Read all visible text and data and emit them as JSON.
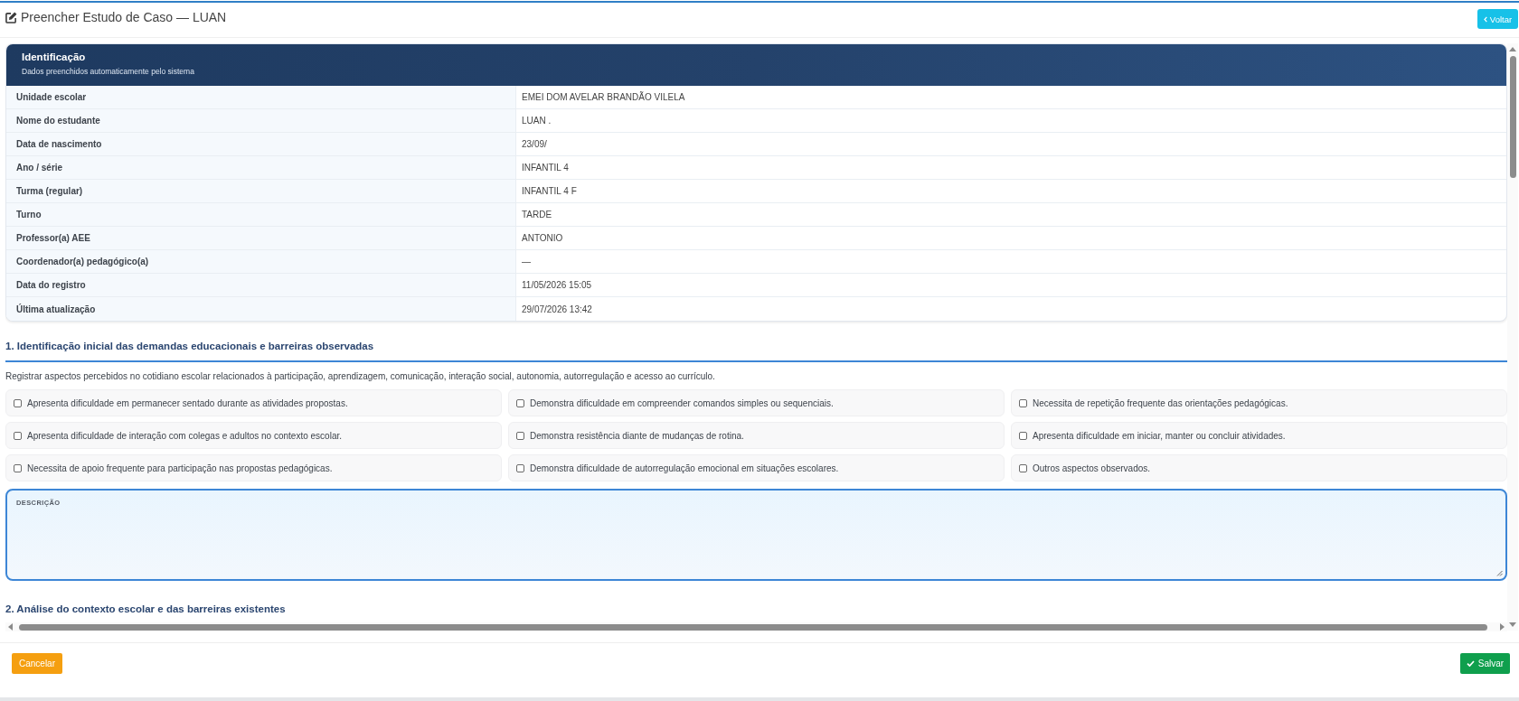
{
  "page": {
    "title": "Preencher Estudo de Caso — LUAN",
    "back_button": "Voltar"
  },
  "identification": {
    "title": "Identificação",
    "subtitle": "Dados preenchidos automaticamente pelo sistema",
    "rows": [
      {
        "label": "Unidade escolar",
        "value": "EMEI DOM AVELAR BRANDÃO VILELA"
      },
      {
        "label": "Nome do estudante",
        "value": "LUAN ."
      },
      {
        "label": "Data de nascimento",
        "value": "23/09/"
      },
      {
        "label": "Ano / série",
        "value": "INFANTIL 4"
      },
      {
        "label": "Turma (regular)",
        "value": "INFANTIL 4 F"
      },
      {
        "label": "Turno",
        "value": "TARDE"
      },
      {
        "label": "Professor(a) AEE",
        "value": "ANTONIO"
      },
      {
        "label": "Coordenador(a) pedagógico(a)",
        "value": "—"
      },
      {
        "label": "Data do registro",
        "value": "11/05/2026 15:05"
      },
      {
        "label": "Última atualização",
        "value": "29/07/2026 13:42"
      }
    ]
  },
  "sections": [
    {
      "title": "1. Identificação inicial das demandas educacionais e barreiras observadas",
      "description": "Registrar aspectos percebidos no cotidiano escolar relacionados à participação, aprendizagem, comunicação, interação social, autonomia, autorregulação e acesso ao currículo.",
      "options": [
        {
          "label": "Apresenta dificuldade em permanecer sentado durante as atividades propostas.",
          "checked": false
        },
        {
          "label": "Demonstra dificuldade em compreender comandos simples ou sequenciais.",
          "checked": false
        },
        {
          "label": "Necessita de repetição frequente das orientações pedagógicas.",
          "checked": false
        },
        {
          "label": "Apresenta dificuldade de interação com colegas e adultos no contexto escolar.",
          "checked": false
        },
        {
          "label": "Demonstra resistência diante de mudanças de rotina.",
          "checked": false
        },
        {
          "label": "Apresenta dificuldade em iniciar, manter ou concluir atividades.",
          "checked": false
        },
        {
          "label": "Necessita de apoio frequente para participação nas propostas pedagógicas.",
          "checked": false
        },
        {
          "label": "Demonstra dificuldade de autorregulação emocional em situações escolares.",
          "checked": false
        },
        {
          "label": "Outros aspectos observados.",
          "checked": false
        }
      ],
      "field": {
        "label": "DESCRIÇÃO"
      }
    },
    {
      "title": "2. Análise do contexto escolar e das barreiras existentes"
    }
  ],
  "footer": {
    "cancel_button": "Cancelar",
    "save_button": "Salvar"
  }
}
